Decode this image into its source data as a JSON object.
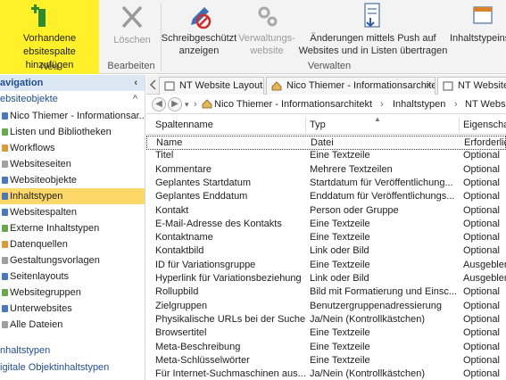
{
  "ribbon": {
    "add_existing": "Vorhandene Websitespalte hinzufügen",
    "add_existing_line1": "Vorhandene",
    "add_existing_line2": "ebsitespalte hinzufügen",
    "group_new": "Neu",
    "delete": "Löschen",
    "group_edit": "Bearbeiten",
    "write_protect_line1": "Schreibgeschützt",
    "write_protect_line2": "anzeigen",
    "mgmt_line1": "Verwaltungs-",
    "mgmt_line2": "website",
    "push_line1": "Änderungen mittels Push auf",
    "push_line2": "Websites und in Listen übertragen",
    "group_manage": "Verwalten",
    "content_types_partial": "Inhaltstypeins"
  },
  "nav": {
    "header": "avigation",
    "section_site_objects": "ebsiteobjekte",
    "items": [
      {
        "label": "Nico Thiemer - Informationsar...",
        "icon": "site-icon"
      },
      {
        "label": "Listen und Bibliotheken",
        "icon": "list-icon"
      },
      {
        "label": "Workflows",
        "icon": "workflow-icon"
      },
      {
        "label": "Websiteseiten",
        "icon": "page-icon"
      },
      {
        "label": "Websiteobjekte",
        "icon": "asset-icon"
      },
      {
        "label": "Inhaltstypen",
        "icon": "content-type-icon",
        "selected": true
      },
      {
        "label": "Websitespalten",
        "icon": "column-icon"
      },
      {
        "label": "Externe Inhaltstypen",
        "icon": "external-icon"
      },
      {
        "label": "Datenquellen",
        "icon": "datasource-icon"
      },
      {
        "label": "Gestaltungsvorlagen",
        "icon": "masterpage-icon"
      },
      {
        "label": "Seitenlayouts",
        "icon": "layout-icon"
      },
      {
        "label": "Websitegruppen",
        "icon": "group-icon"
      },
      {
        "label": "Unterwebsites",
        "icon": "subsite-icon"
      },
      {
        "label": "Alle Dateien",
        "icon": "files-icon"
      }
    ],
    "section_content_types": "nhaltstypen",
    "section_digital": "igitale Objektinhaltstypen"
  },
  "tabs": [
    {
      "label": "NT Website Layout"
    },
    {
      "label": "Nico Thiemer - Informationsarchitekt"
    },
    {
      "label": "NT Website"
    }
  ],
  "breadcrumb": {
    "path": [
      "Nico Thiemer - Informationsarchitekt",
      "Inhaltstypen",
      "NT Websi"
    ]
  },
  "table": {
    "headers": [
      "Spaltenname",
      "Typ",
      "Eigenschaft"
    ],
    "rows": [
      [
        "Name",
        "Datei",
        "Erforderlich"
      ],
      [
        "Titel",
        "Eine Textzeile",
        "Optional"
      ],
      [
        "Kommentare",
        "Mehrere Textzeilen",
        "Optional"
      ],
      [
        "Geplantes Startdatum",
        "Startdatum für Veröffentlichung...",
        "Optional"
      ],
      [
        "Geplantes Enddatum",
        "Enddatum für Veröffentlichungs...",
        "Optional"
      ],
      [
        "Kontakt",
        "Person oder Gruppe",
        "Optional"
      ],
      [
        "E-Mail-Adresse des Kontakts",
        "Eine Textzeile",
        "Optional"
      ],
      [
        "Kontaktname",
        "Eine Textzeile",
        "Optional"
      ],
      [
        "Kontaktbild",
        "Link oder Bild",
        "Optional"
      ],
      [
        "ID für Variationsgruppe",
        "Eine Textzeile",
        "Ausgeblendet"
      ],
      [
        "Hyperlink für Variationsbeziehung",
        "Link oder Bild",
        "Ausgeblendet"
      ],
      [
        "Rollupbild",
        "Bild mit Formatierung und Einsc...",
        "Optional"
      ],
      [
        "Zielgruppen",
        "Benutzergruppenadressierung",
        "Optional"
      ],
      [
        "Physikalische URLs bei der Suche ...",
        "Ja/Nein (Kontrollkästchen)",
        "Optional"
      ],
      [
        "Browsertitel",
        "Eine Textzeile",
        "Optional"
      ],
      [
        "Meta-Beschreibung",
        "Eine Textzeile",
        "Optional"
      ],
      [
        "Meta-Schlüsselwörter",
        "Eine Textzeile",
        "Optional"
      ],
      [
        "Für Internet-Suchmaschinen aus...",
        "Ja/Nein (Kontrollkästchen)",
        "Optional"
      ]
    ]
  },
  "colors": {
    "highlight_yellow": "#fff02a",
    "selected_nav": "#fcd86a",
    "nav_blue": "#1f4e8c"
  }
}
